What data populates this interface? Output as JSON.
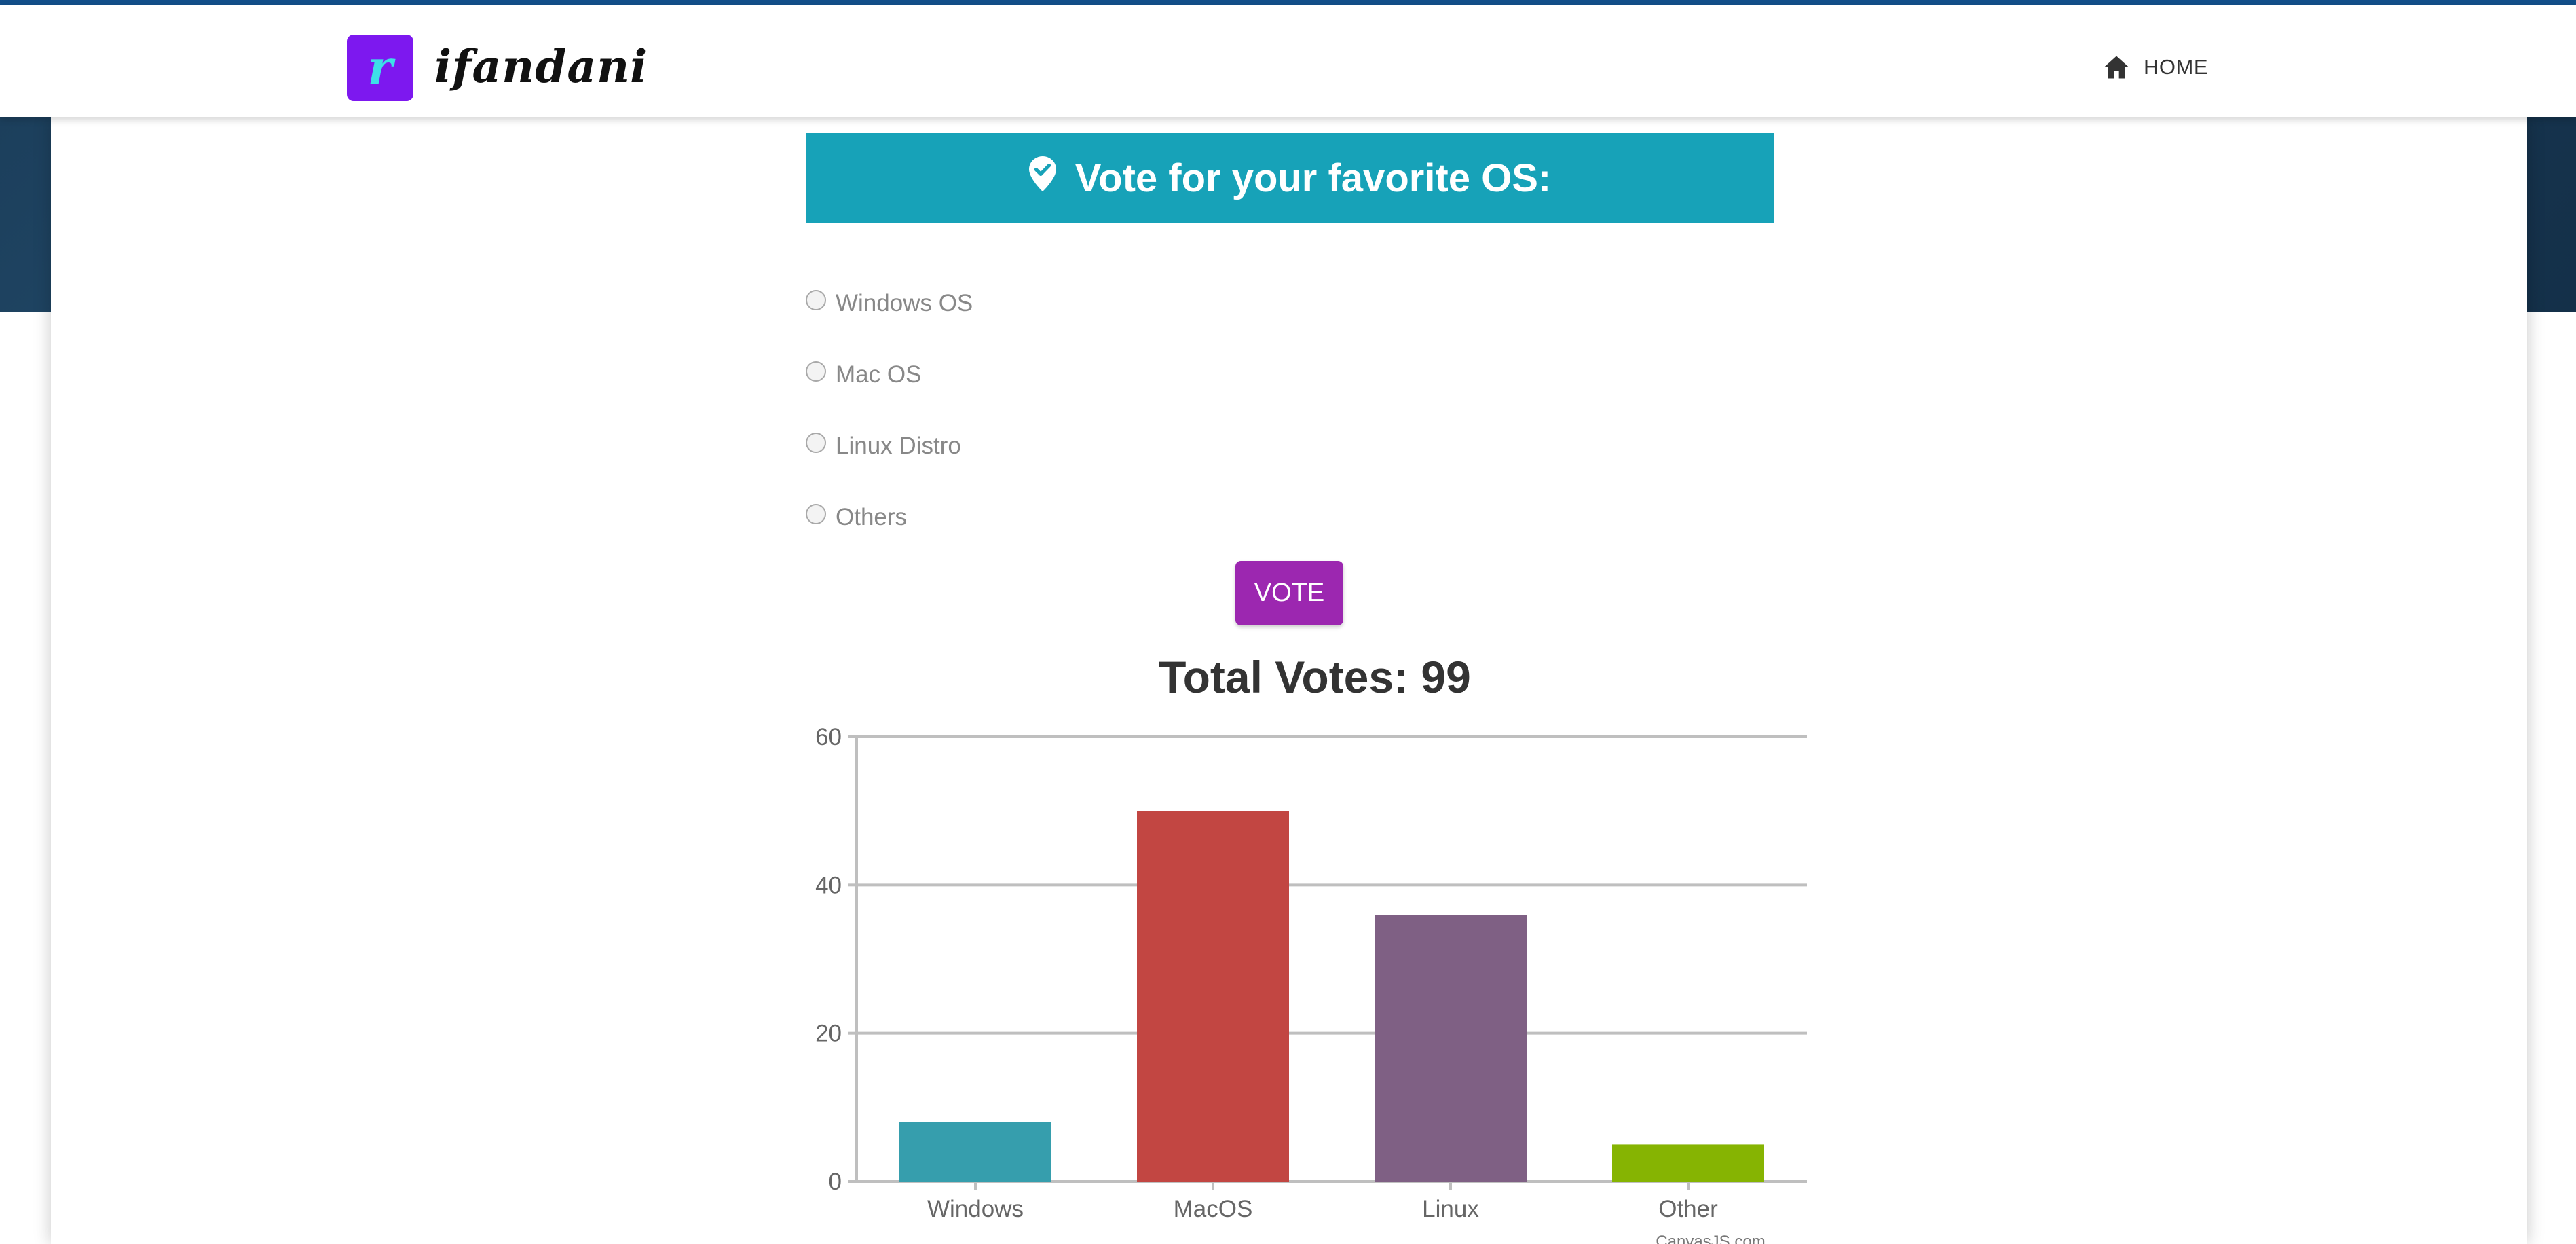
{
  "header": {
    "brand": "ifandani",
    "logo_letter": "r",
    "nav_home": "HOME"
  },
  "poll": {
    "title": "Vote for your favorite OS:",
    "options": [
      {
        "label": "Windows OS"
      },
      {
        "label": "Mac OS"
      },
      {
        "label": "Linux Distro"
      },
      {
        "label": "Others"
      }
    ],
    "vote_button": "VOTE"
  },
  "colors": {
    "header_bar": "#17a2b8",
    "vote_button": "#9c27b0",
    "logo": "#7d18ef"
  },
  "chart_data": {
    "type": "bar",
    "title": "Total Votes: 99",
    "categories": [
      "Windows",
      "MacOS",
      "Linux",
      "Other"
    ],
    "values": [
      8,
      50,
      36,
      5
    ],
    "colors": [
      "#369ead",
      "#c24642",
      "#7f6084",
      "#86b402"
    ],
    "yticks": [
      0,
      20,
      40,
      60
    ],
    "ylim": [
      0,
      60
    ],
    "grid": true,
    "credit": "CanvasJS.com"
  }
}
